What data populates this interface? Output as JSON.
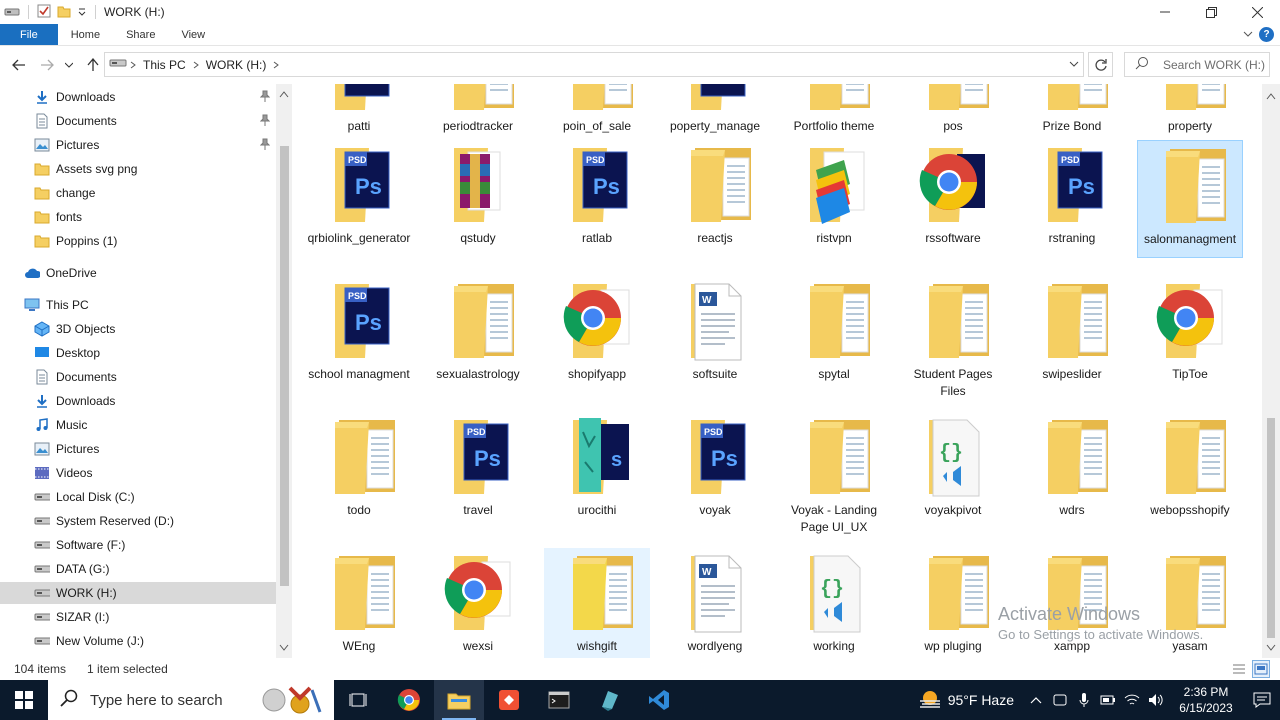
{
  "window": {
    "title": "WORK (H:)",
    "controls": {
      "minimize": "minimize",
      "restore": "restore",
      "close": "close"
    }
  },
  "ribbon": {
    "tabs": [
      "File",
      "Home",
      "Share",
      "View"
    ]
  },
  "address": {
    "crumbs": [
      "This PC",
      "WORK (H:)"
    ],
    "search_placeholder": "Search WORK (H:)"
  },
  "navpane": {
    "items": [
      {
        "label": "Downloads",
        "icon": "download-arrow-icon",
        "pinned": true
      },
      {
        "label": "Documents",
        "icon": "documents-icon",
        "pinned": true
      },
      {
        "label": "Pictures",
        "icon": "pictures-icon",
        "pinned": true
      },
      {
        "label": "Assets svg png",
        "icon": "folder-icon"
      },
      {
        "label": "change",
        "icon": "folder-icon"
      },
      {
        "label": "fonts",
        "icon": "folder-icon"
      },
      {
        "label": "Poppins (1)",
        "icon": "folder-icon"
      },
      {
        "label": "OneDrive",
        "icon": "onedrive-cloud-icon"
      },
      {
        "label": "This PC",
        "icon": "computer-icon"
      },
      {
        "label": "3D Objects",
        "icon": "3d-objects-icon"
      },
      {
        "label": "Desktop",
        "icon": "desktop-icon"
      },
      {
        "label": "Documents",
        "icon": "documents-icon"
      },
      {
        "label": "Downloads",
        "icon": "download-arrow-icon"
      },
      {
        "label": "Music",
        "icon": "music-icon"
      },
      {
        "label": "Pictures",
        "icon": "pictures-icon"
      },
      {
        "label": "Videos",
        "icon": "videos-icon"
      },
      {
        "label": "Local Disk (C:)",
        "icon": "drive-icon"
      },
      {
        "label": "System Reserved (D:)",
        "icon": "drive-icon"
      },
      {
        "label": "Software (F:)",
        "icon": "drive-icon"
      },
      {
        "label": "DATA (G:)",
        "icon": "drive-icon"
      },
      {
        "label": "WORK (H:)",
        "icon": "drive-icon",
        "selected": true
      },
      {
        "label": "SIZAR (I:)",
        "icon": "drive-icon"
      },
      {
        "label": "New Volume (J:)",
        "icon": "drive-icon"
      }
    ]
  },
  "files": [
    {
      "label": "patti",
      "type": "psd"
    },
    {
      "label": "periodtracker",
      "type": "folder"
    },
    {
      "label": "poin_of_sale",
      "type": "folder"
    },
    {
      "label": "poperty_manage",
      "type": "psd"
    },
    {
      "label": "Portfolio theme",
      "type": "folder"
    },
    {
      "label": "pos",
      "type": "folder"
    },
    {
      "label": "Prize Bond",
      "type": "folder"
    },
    {
      "label": "property",
      "type": "folder"
    },
    {
      "label": "qrbiolink_generator",
      "type": "psd"
    },
    {
      "label": "qstudy",
      "type": "winrar"
    },
    {
      "label": "ratlab",
      "type": "psd"
    },
    {
      "label": "reactjs",
      "type": "folder"
    },
    {
      "label": "ristvpn",
      "type": "bluestacks"
    },
    {
      "label": "rssoftware",
      "type": "chrome-psd"
    },
    {
      "label": "rstraning",
      "type": "psd"
    },
    {
      "label": "salonmanagment",
      "type": "folder",
      "selected": true
    },
    {
      "label": "school managment",
      "type": "psd"
    },
    {
      "label": "sexualastrology",
      "type": "folder"
    },
    {
      "label": "shopifyapp",
      "type": "chrome"
    },
    {
      "label": "softsuite",
      "type": "doc"
    },
    {
      "label": "spytal",
      "type": "folder"
    },
    {
      "label": "Student Pages Files",
      "type": "folder"
    },
    {
      "label": "swipeslider",
      "type": "folder"
    },
    {
      "label": "TipToe",
      "type": "chrome"
    },
    {
      "label": "todo",
      "type": "folder"
    },
    {
      "label": "travel",
      "type": "psd"
    },
    {
      "label": "urocithi",
      "type": "teal-psd"
    },
    {
      "label": "voyak",
      "type": "psd"
    },
    {
      "label": "Voyak - Landing Page UI_UX",
      "type": "folder"
    },
    {
      "label": "voyakpivot",
      "type": "code"
    },
    {
      "label": "wdrs",
      "type": "folder"
    },
    {
      "label": "webopsshopify",
      "type": "folder"
    },
    {
      "label": "WEng",
      "type": "folder"
    },
    {
      "label": "wexsi",
      "type": "chrome"
    },
    {
      "label": "wishgift",
      "type": "folder-yellow",
      "hovered": true
    },
    {
      "label": "wordlyeng",
      "type": "doc"
    },
    {
      "label": "working",
      "type": "code"
    },
    {
      "label": "wp pluging",
      "type": "folder"
    },
    {
      "label": "xampp",
      "type": "folder"
    },
    {
      "label": "yasam",
      "type": "folder"
    }
  ],
  "status": {
    "count": "104 items",
    "selection": "1 item selected"
  },
  "watermark": {
    "line1": "Activate Windows",
    "line2": "Go to Settings to activate Windows."
  },
  "taskbar": {
    "search_placeholder": "Type here to search",
    "weather": "95°F  Haze",
    "time": "2:36 PM",
    "date": "6/15/2023"
  },
  "colors": {
    "accent": "#1a6fc0",
    "selection": "#cce8ff",
    "folder": "#f5cf62",
    "taskbar": "#0b1a2c"
  }
}
